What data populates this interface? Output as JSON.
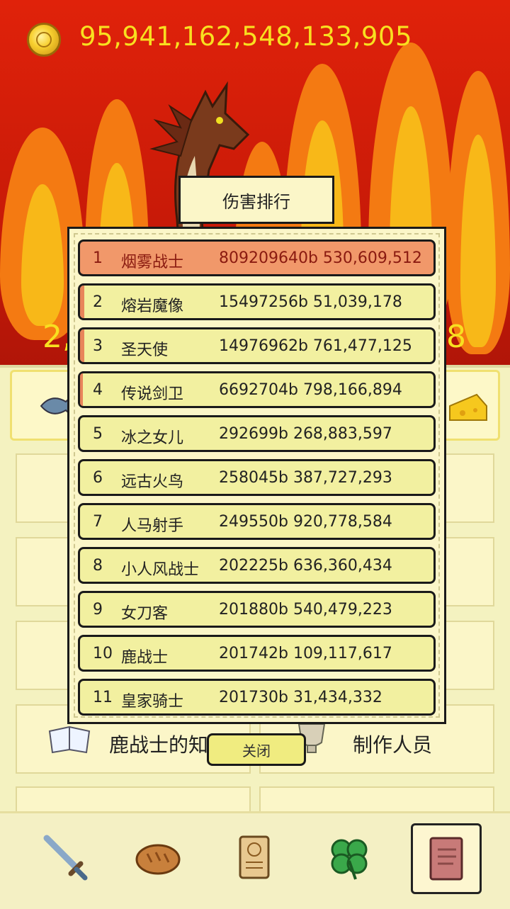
{
  "header": {
    "coin_icon": "gold-coin-icon",
    "coin_amount": "95,941,162,548,133,905"
  },
  "background": {
    "left_number": "2,",
    "right_number": "8"
  },
  "menu": {
    "tile_knowledge_label": "鹿战士的知识",
    "tile_credits_label": "制作人员"
  },
  "ranking": {
    "title": "伤害排行",
    "close_label": "关闭",
    "rows": [
      {
        "rank": "1",
        "name": "烟雾战士",
        "damage": "809209640b 530,609,512"
      },
      {
        "rank": "2",
        "name": "熔岩魔像",
        "damage": "15497256b 51,039,178"
      },
      {
        "rank": "3",
        "name": "圣天使",
        "damage": "14976962b 761,477,125"
      },
      {
        "rank": "4",
        "name": "传说剑卫",
        "damage": "6692704b 798,166,894"
      },
      {
        "rank": "5",
        "name": "冰之女儿",
        "damage": "292699b 268,883,597"
      },
      {
        "rank": "6",
        "name": "远古火鸟",
        "damage": "258045b 387,727,293"
      },
      {
        "rank": "7",
        "name": "人马射手",
        "damage": "249550b 920,778,584"
      },
      {
        "rank": "8",
        "name": "小人风战士",
        "damage": "202225b 636,360,434"
      },
      {
        "rank": "9",
        "name": "女刀客",
        "damage": "201880b 540,479,223"
      },
      {
        "rank": "10",
        "name": "鹿战士",
        "damage": "201742b 109,117,617"
      },
      {
        "rank": "11",
        "name": "皇家骑士",
        "damage": "201730b 31,434,332"
      }
    ]
  },
  "bottom_nav": {
    "items": [
      "sword-icon",
      "bread-icon",
      "scroll-icon",
      "clover-icon",
      "book-icon"
    ],
    "active": "book-icon"
  },
  "colors": {
    "gold_text": "#f8e020",
    "fire_red": "#c81a08",
    "panel_cream": "#fbf6c8",
    "highlight_row": "#f1986a"
  }
}
